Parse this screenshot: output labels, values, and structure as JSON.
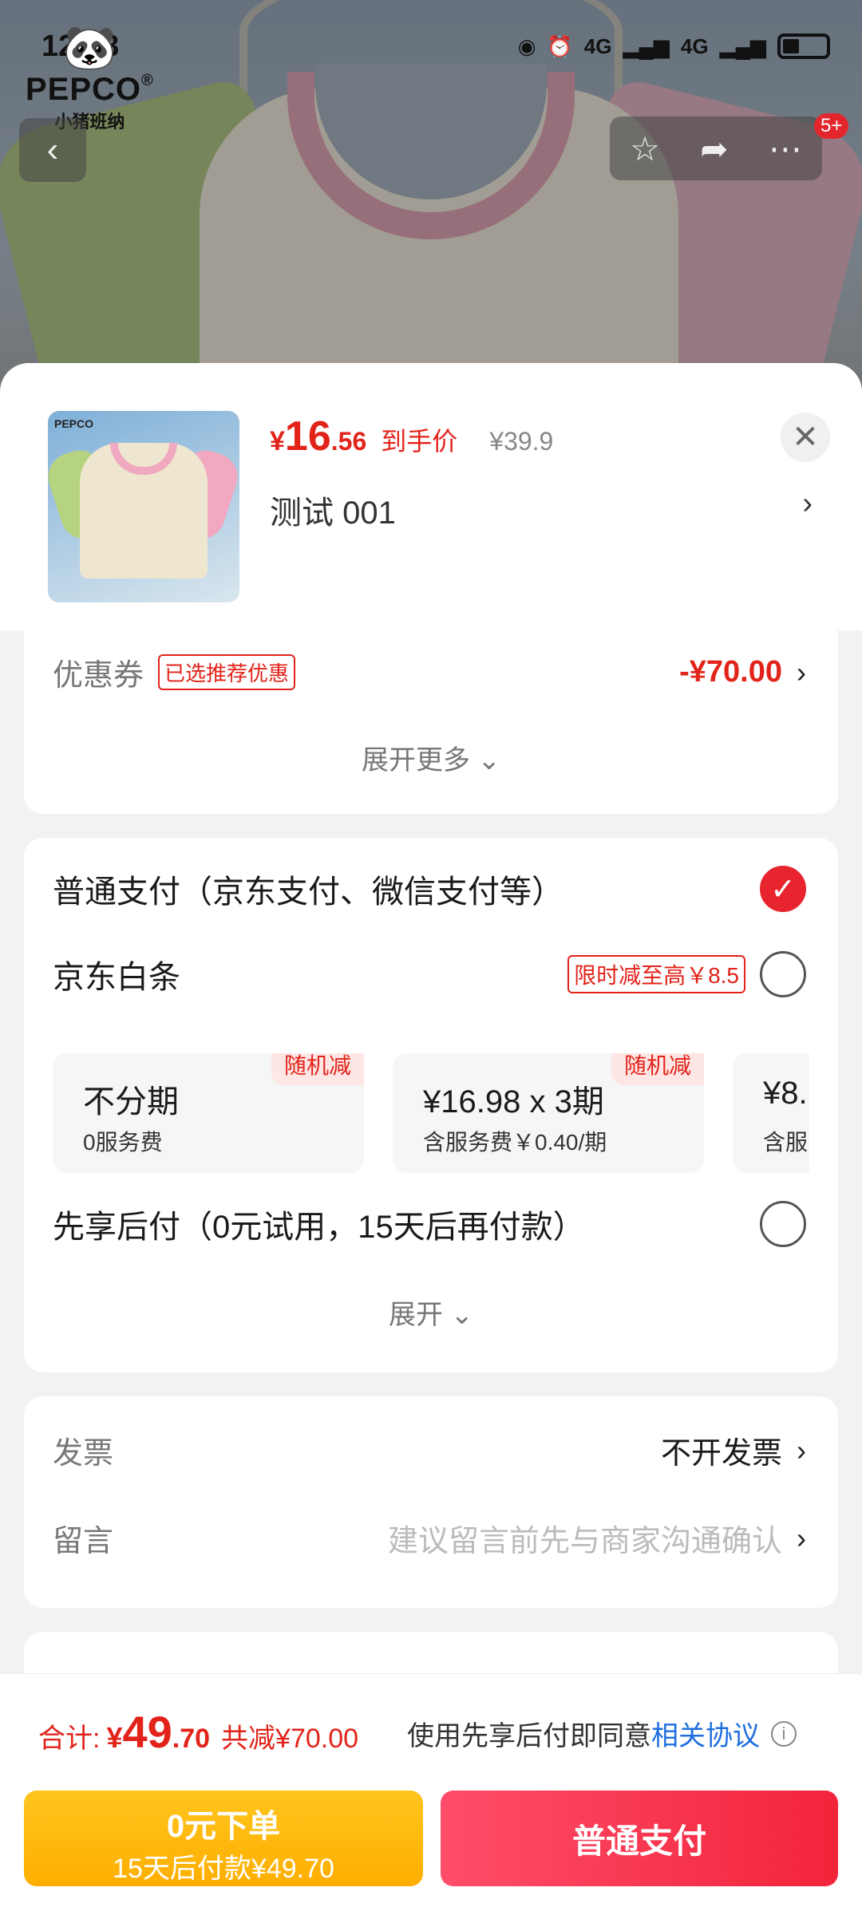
{
  "status_bar": {
    "time": "12:08",
    "net1": "4G",
    "net2": "4G"
  },
  "brand": {
    "name": "PEPCO",
    "reg": "®",
    "sub": "小猪班纳"
  },
  "header": {
    "badge": "5+"
  },
  "product": {
    "currency": "¥",
    "price_int": "16",
    "price_dec": ".56",
    "price_label": "到手价",
    "original_price": "¥39.9",
    "variant": "测试  001"
  },
  "coupon": {
    "label": "优惠券",
    "tag": "已选推荐优惠",
    "amount": "-¥70.00",
    "expand_more": "展开更多"
  },
  "payment": {
    "normal_title": "普通支付（京东支付、微信支付等）",
    "baitiao_title": "京东白条",
    "baitiao_promo": "限时减至高￥8.5",
    "plans": [
      {
        "title": "不分期",
        "sub": "0服务费",
        "badge": "随机减"
      },
      {
        "title": "¥16.98 x 3期",
        "sub": "含服务费￥0.40/期",
        "badge": "随机减"
      },
      {
        "title": "¥8.",
        "sub": "含服",
        "badge": ""
      }
    ],
    "later_title": "先享后付（0元试用，15天后再付款）",
    "expand": "展开"
  },
  "invoice": {
    "label": "发票",
    "value": "不开发票"
  },
  "message": {
    "label": "留言",
    "placeholder": "建议留言前先与商家沟通确认"
  },
  "footer": {
    "total_label": "合计:",
    "total_cur": "¥",
    "total_int": "49",
    "total_dec": ".70",
    "total_reduce": "共减¥70.00",
    "agree_text": "使用先享后付即同意",
    "agree_link": "相关协议",
    "btn_later_title": "0元下单",
    "btn_later_sub": "15天后付款¥49.70",
    "btn_normal": "普通支付"
  },
  "colors": {
    "accent": "#e2231a",
    "yellow": "#ffb400",
    "link": "#1f6fe0"
  }
}
